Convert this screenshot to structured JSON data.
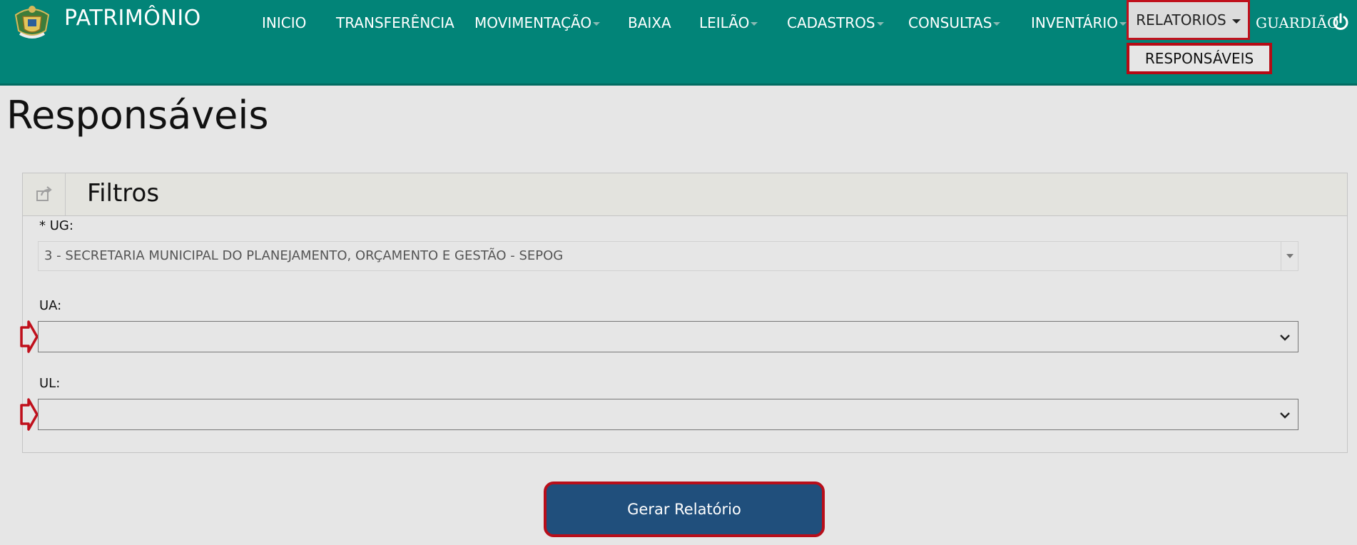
{
  "header": {
    "brand": "PATRIMÔNIO",
    "nav": [
      {
        "label": "INICIO"
      },
      {
        "label": "TRANSFERÊNCIA"
      },
      {
        "label": "MOVIMENTAÇÃO"
      },
      {
        "label": "BAIXA"
      },
      {
        "label": "LEILÃO"
      },
      {
        "label": "CADASTROS"
      },
      {
        "label": "CONSULTAS"
      },
      {
        "label": "INVENTÁRIO"
      }
    ],
    "active_menu": "RELATORIOS",
    "dropdown_item": "RESPONSÁVEIS",
    "user": "GUARDIÃO"
  },
  "page": {
    "title": "Responsáveis"
  },
  "filters": {
    "title": "Filtros",
    "ug_label": "* UG:",
    "ug_value": "3 - SECRETARIA MUNICIPAL DO PLANEJAMENTO, ORÇAMENTO E GESTÃO - SEPOG",
    "ua_label": "UA:",
    "ua_value": "",
    "ul_label": "UL:",
    "ul_value": ""
  },
  "actions": {
    "generate_label": "Gerar Relatório"
  },
  "colors": {
    "header_bg": "#028478",
    "highlight": "#c0101c",
    "button_bg": "#204f7c"
  }
}
